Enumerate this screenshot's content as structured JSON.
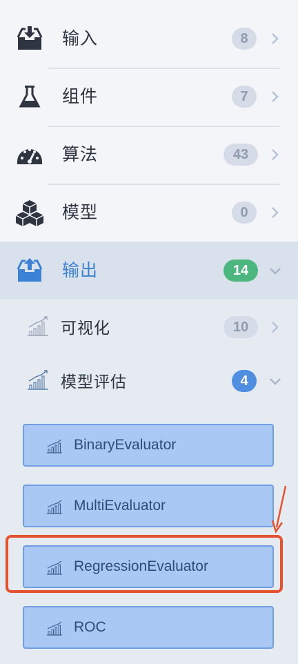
{
  "menu": {
    "items": [
      {
        "label": "输入",
        "count": "8"
      },
      {
        "label": "组件",
        "count": "7"
      },
      {
        "label": "算法",
        "count": "43"
      },
      {
        "label": "模型",
        "count": "0"
      },
      {
        "label": "输出",
        "count": "14"
      }
    ],
    "submenu": [
      {
        "label": "可视化",
        "count": "10"
      },
      {
        "label": "模型评估",
        "count": "4"
      }
    ],
    "evaluators": [
      {
        "label": "BinaryEvaluator"
      },
      {
        "label": "MultiEvaluator"
      },
      {
        "label": "RegressionEvaluator"
      },
      {
        "label": "ROC"
      }
    ]
  },
  "colors": {
    "accent_blue": "#3b82d6",
    "badge_green": "#4bb77f",
    "badge_blue": "#4f8ee0",
    "highlight_red": "#e5532e",
    "leaf_fill": "#a9c8f4"
  }
}
